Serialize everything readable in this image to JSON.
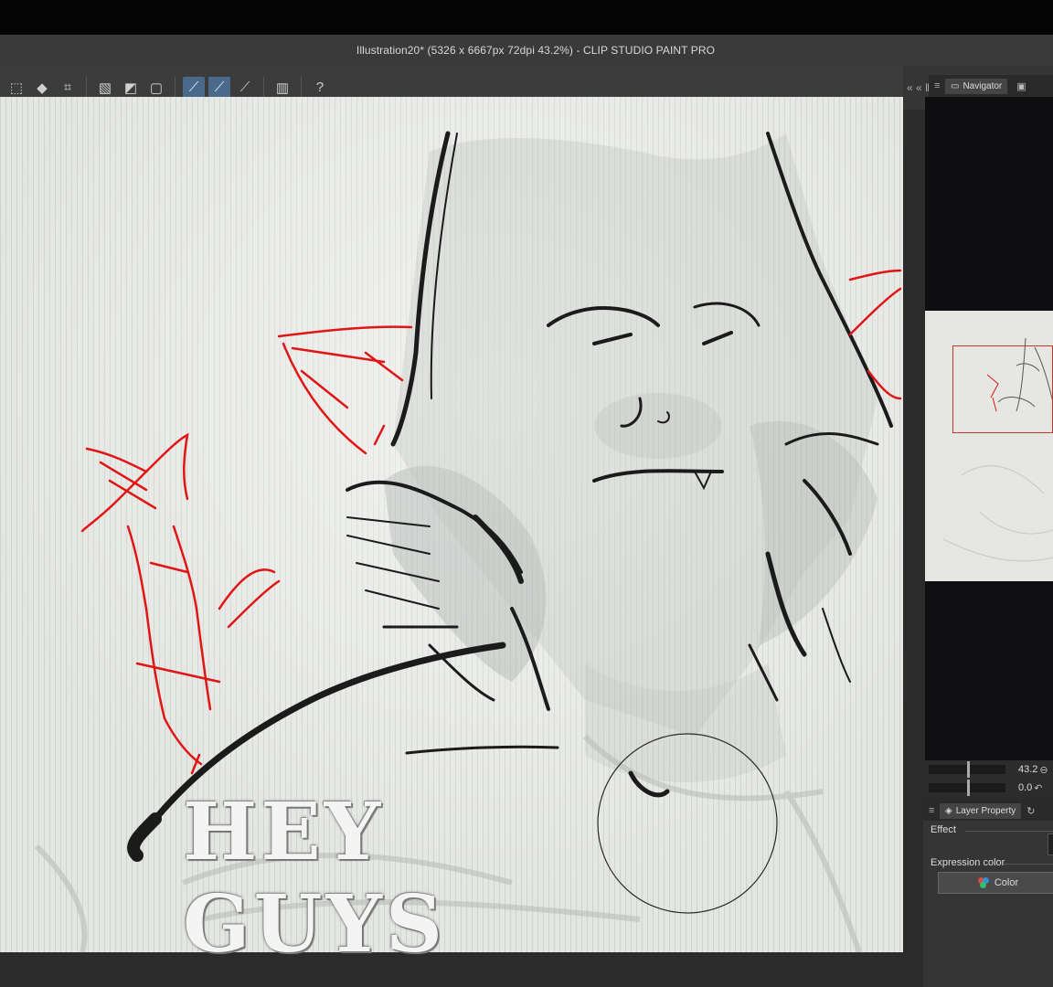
{
  "window": {
    "title": "Illustration20* (5326 x 6667px 72dpi 43.2%)  - CLIP STUDIO PAINT PRO"
  },
  "toolbar": {
    "tools": [
      {
        "name": "select-rectangle-icon",
        "glyph": "⬚",
        "active": false
      },
      {
        "name": "fill-bucket-icon",
        "glyph": "◆",
        "active": false
      },
      {
        "name": "crop-icon",
        "glyph": "⌗",
        "active": false
      },
      {
        "name": "selection-clear-icon",
        "glyph": "▧",
        "active": false
      },
      {
        "name": "selection-invert-icon",
        "glyph": "◩",
        "active": false
      },
      {
        "name": "selection-crop-icon",
        "glyph": "▢",
        "active": false
      },
      {
        "name": "ruler-snap-icon",
        "glyph": "⟋",
        "active": true
      },
      {
        "name": "special-ruler-snap-icon",
        "glyph": "⟋",
        "active": true
      },
      {
        "name": "grid-snap-icon",
        "glyph": "⟋",
        "active": false
      },
      {
        "name": "device-icon",
        "glyph": "▥",
        "active": false
      },
      {
        "name": "help-icon",
        "glyph": "?",
        "active": false
      }
    ],
    "dock_arrows": "« « ‖"
  },
  "navigator": {
    "menu_glyph": "≡",
    "tab_label": "Navigator",
    "zoom_value": "43.2",
    "rotation_value": "0.0"
  },
  "layer_property": {
    "menu_glyph": "≡",
    "tab_label": "Layer Property",
    "effect_label": "Effect",
    "expression_color_label": "Expression color",
    "color_button_label": "Color"
  },
  "canvas": {
    "overlay_caption": "HEY GUYS",
    "colors": {
      "paper": "#e4e6e2",
      "ink": "#1b1b1b",
      "red_sketch": "#e01616",
      "gray_wash": "#9aa09c"
    }
  }
}
